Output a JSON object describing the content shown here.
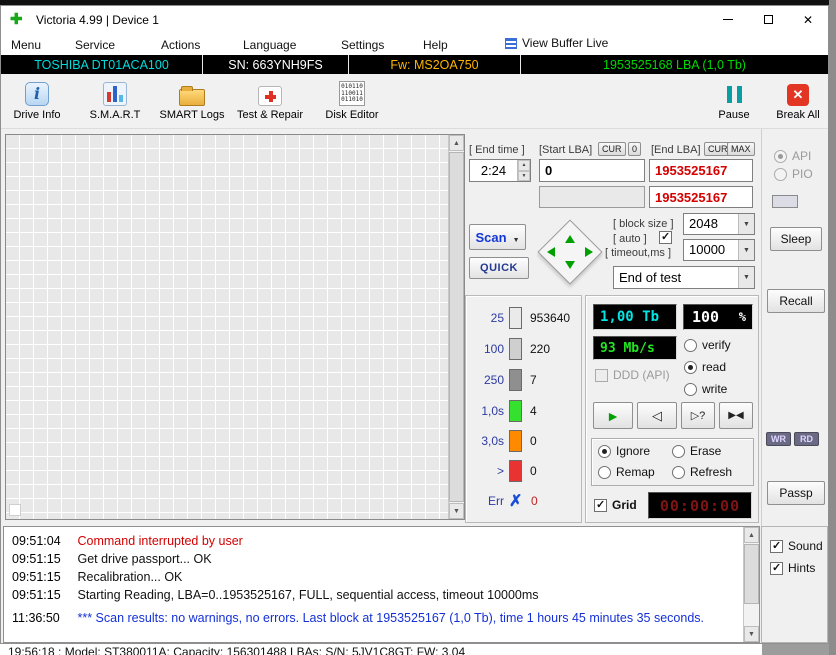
{
  "window": {
    "title": "Victoria 4.99 | Device 1"
  },
  "menu": {
    "items": [
      "Menu",
      "Service",
      "Actions",
      "Language",
      "Settings",
      "Help"
    ],
    "view_buffer_label": "View Buffer Live"
  },
  "device_bar": {
    "model": "TOSHIBA DT01ACA100",
    "serial": "SN: 663YNH9FS",
    "firmware": "Fw: MS2OA750",
    "capacity": "1953525168 LBA (1,0 Tb)"
  },
  "toolbar": {
    "drive_info": "Drive Info",
    "smart": "S.M.A.R.T",
    "smart_logs": "SMART Logs",
    "test_repair": "Test & Repair",
    "disk_editor": "Disk Editor",
    "pause": "Pause",
    "break_all": "Break All",
    "disk_editor_icon": [
      "010110",
      "110011",
      "011010"
    ]
  },
  "params": {
    "end_time_label": "[ End time ]",
    "end_time_value": "2:24",
    "start_lba_label": "[Start LBA]",
    "end_lba_label": "[End LBA]",
    "cur_chip": "CUR",
    "zero_chip": "0",
    "max_chip": "MAX",
    "start_lba_value": "0",
    "end_lba_value": "1953525167",
    "end_lba_value2": "1953525167",
    "scan_label": "Scan",
    "quick_label": "QUICK",
    "block_size_label": "[ block size ]",
    "block_size_value": "2048",
    "auto_label": "[ auto ]",
    "timeout_label": "[ timeout,ms ]",
    "timeout_value": "10000",
    "end_of_test_value": "End of test"
  },
  "stats": {
    "rows": [
      {
        "label": "25",
        "count": "953640",
        "color": "#eaeaea"
      },
      {
        "label": "100",
        "count": "220",
        "color": "#cfcfcf"
      },
      {
        "label": "250",
        "count": "7",
        "color": "#8f8f8f"
      },
      {
        "label": "1,0s",
        "count": "4",
        "color": "#35e02e"
      },
      {
        "label": "3,0s",
        "count": "0",
        "color": "#ff8a00"
      },
      {
        "label": ">",
        "count": "0",
        "color": "#e93232"
      },
      {
        "label": "Err",
        "count": "0",
        "color": ""
      }
    ]
  },
  "monitor": {
    "capacity_display": "1,00 Tb",
    "progress_value": "100",
    "progress_unit": "%",
    "speed_display": "93 Mb/s",
    "ddd_label": "DDD (API)",
    "verify_label": "verify",
    "read_label": "read",
    "write_label": "write",
    "transport": {
      "play": "►",
      "prev": "◁",
      "next_q": "▷?",
      "both": "▶◀"
    },
    "ignore_label": "Ignore",
    "erase_label": "Erase",
    "remap_label": "Remap",
    "refresh_label": "Refresh",
    "grid_label": "Grid",
    "timer_display": "00:00:00"
  },
  "side": {
    "api_label": "API",
    "pio_label": "PIO",
    "sleep_label": "Sleep",
    "recall_label": "Recall",
    "wr_label": "WR",
    "rd_label": "RD",
    "passp_label": "Passp",
    "sound_label": "Sound",
    "hints_label": "Hints"
  },
  "log": {
    "lines": [
      {
        "time": "09:51:04",
        "text": "Command interrupted by user"
      },
      {
        "time": "09:51:15",
        "text": "Get drive passport... OK"
      },
      {
        "time": "09:51:15",
        "text": "Recalibration... OK"
      },
      {
        "time": "09:51:15",
        "text": "Starting Reading, LBA=0..1953525167, FULL, sequential access, timeout 10000ms"
      },
      {
        "time": "11:36:50",
        "text": "*** Scan results: no warnings, no errors. Last block at 1953525167 (1,0 Tb), time 1 hours 45 minutes 35 seconds."
      }
    ]
  },
  "background_window": {
    "partial_log_line": "19:56:18 : Model: ST380011A; Capacity: 156301488 LBAs; S/N: 5JV1C8GT; FW: 3.04"
  },
  "colors": {
    "model_text": "#00dcdc",
    "serial_text": "#ffffff",
    "firmware_text": "#ffb400",
    "capacity_text": "#00d800",
    "lba_value_text": "#d40000",
    "capacity_display_text": "#00e5e5",
    "speed_display_text": "#23e523",
    "timer_display_text": "#7d1515"
  }
}
